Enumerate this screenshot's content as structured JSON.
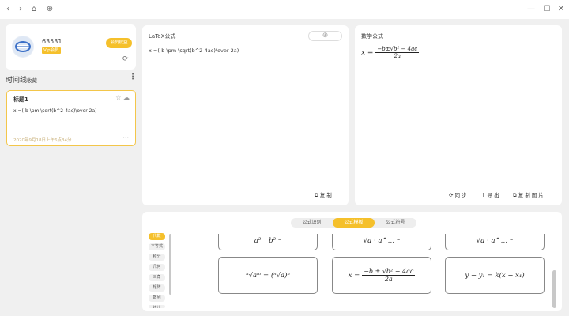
{
  "titlebar": {
    "back_icon": "‹",
    "forward_icon": "›",
    "home_icon": "⌂",
    "add_icon": "⊕",
    "minimize_icon": "—",
    "maximize_icon": "☐",
    "close_icon": "✕"
  },
  "user": {
    "id": "63531",
    "vip_label": "Vip会员",
    "pay_label": "会员权益",
    "refresh_icon": "⟳"
  },
  "timeline": {
    "title": "时间线",
    "favorites": "收藏",
    "menu_icon": "⋮",
    "records": [
      {
        "title": "标题1",
        "star_icon": "☆",
        "cloud_icon": "☁",
        "latex": "x =(-b \\pm \\sqrt(b^2-4ac)\\over 2a)",
        "time": "2020年9月18日上午6点34分",
        "more_icon": "···"
      }
    ]
  },
  "latex_panel": {
    "title": "LaTeX公式",
    "add_icon": "⊕",
    "content": "x =(-b \\pm \\sqrt(b^2-4ac)\\over 2a)",
    "copy_label": "⧉ 复 制"
  },
  "math_panel": {
    "title": "数学公式",
    "formula_lhs": "x =",
    "formula_num": "−b±√b² − 4ac",
    "formula_den": "2a",
    "sync_label": "⟳ 同 步",
    "export_label": "↑ 导 出",
    "copy_image_label": "⧉ 复 制 图 片"
  },
  "bottom": {
    "tabs": [
      {
        "label": "公式识别",
        "active": false
      },
      {
        "label": "公式模板",
        "active": true
      },
      {
        "label": "公式符号",
        "active": false
      }
    ],
    "categories": [
      {
        "label": "代数",
        "active": true
      },
      {
        "label": "不等式",
        "active": false
      },
      {
        "label": "积分",
        "active": false
      },
      {
        "label": "几何",
        "active": false
      },
      {
        "label": "三角",
        "active": false
      },
      {
        "label": "矩阵",
        "active": false
      },
      {
        "label": "数列",
        "active": false
      },
      {
        "label": "统计",
        "active": false
      }
    ],
    "templates_row1": [
      "a² ⁻ b² ⁼",
      "√a ⋅ a^… ⁼",
      "√a ⋅ a^… ⁼"
    ],
    "templates_row2": [
      "ⁿ√aᵐ = (ⁿ√a)ⁿ",
      "quadratic",
      "y − y₁ = k(x − x₁)"
    ],
    "quad": {
      "lhs": "x =",
      "num": "−b ± √b² − 4ac",
      "den": "2a"
    }
  }
}
